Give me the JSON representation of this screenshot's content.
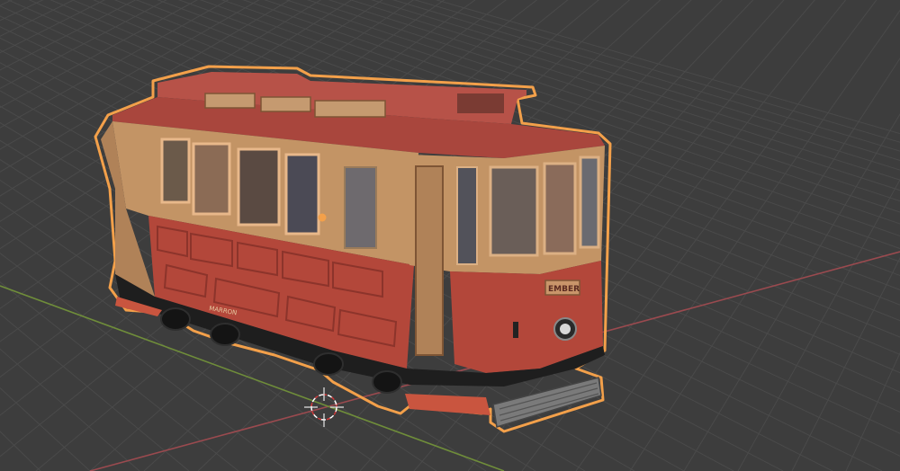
{
  "viewport": {
    "background_color": "#3d3d3d",
    "grid_color": "#4a4a4a",
    "x_axis_color": "#9a4a4f",
    "y_axis_color": "#6f8d3a",
    "selection_outline_color": "#f3a04a",
    "origin_point_color": "#f3a04a"
  },
  "selected_object": {
    "icon": "tram-model-icon",
    "body_color": "#b3473a",
    "roof_color": "#b75248",
    "frame_color": "#c39465",
    "plate_text": "EMBER",
    "side_plate_text": "MARRON"
  },
  "cursor_3d": {
    "icon": "3d-cursor-icon"
  }
}
